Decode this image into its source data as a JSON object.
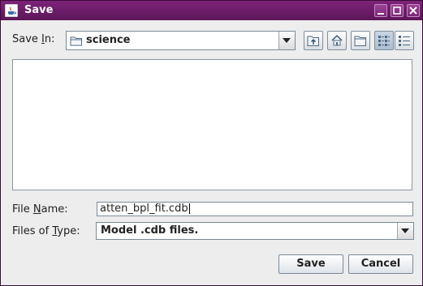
{
  "window": {
    "title": "Save"
  },
  "save_in": {
    "label_pre": "Save ",
    "label_mnemonic": "I",
    "label_post": "n:",
    "value": "science",
    "folder_icon": "folder-icon"
  },
  "toolbar": {
    "up_icon": "up-one-level-icon",
    "home_icon": "home-icon",
    "new_folder_icon": "new-folder-icon",
    "list_icon": "list-view-icon",
    "details_icon": "details-view-icon"
  },
  "file_name": {
    "label_pre": "File ",
    "label_mnemonic": "N",
    "label_post": "ame:",
    "value": "atten_bpl_fit.cdb"
  },
  "file_type": {
    "label_pre": "Files of ",
    "label_mnemonic": "T",
    "label_post": "ype:",
    "value": "Model .cdb files."
  },
  "buttons": {
    "save": "Save",
    "cancel": "Cancel"
  },
  "colors": {
    "titlebar": "#6b1c66",
    "background": "#ededed",
    "accent": "#7e8e9d"
  }
}
